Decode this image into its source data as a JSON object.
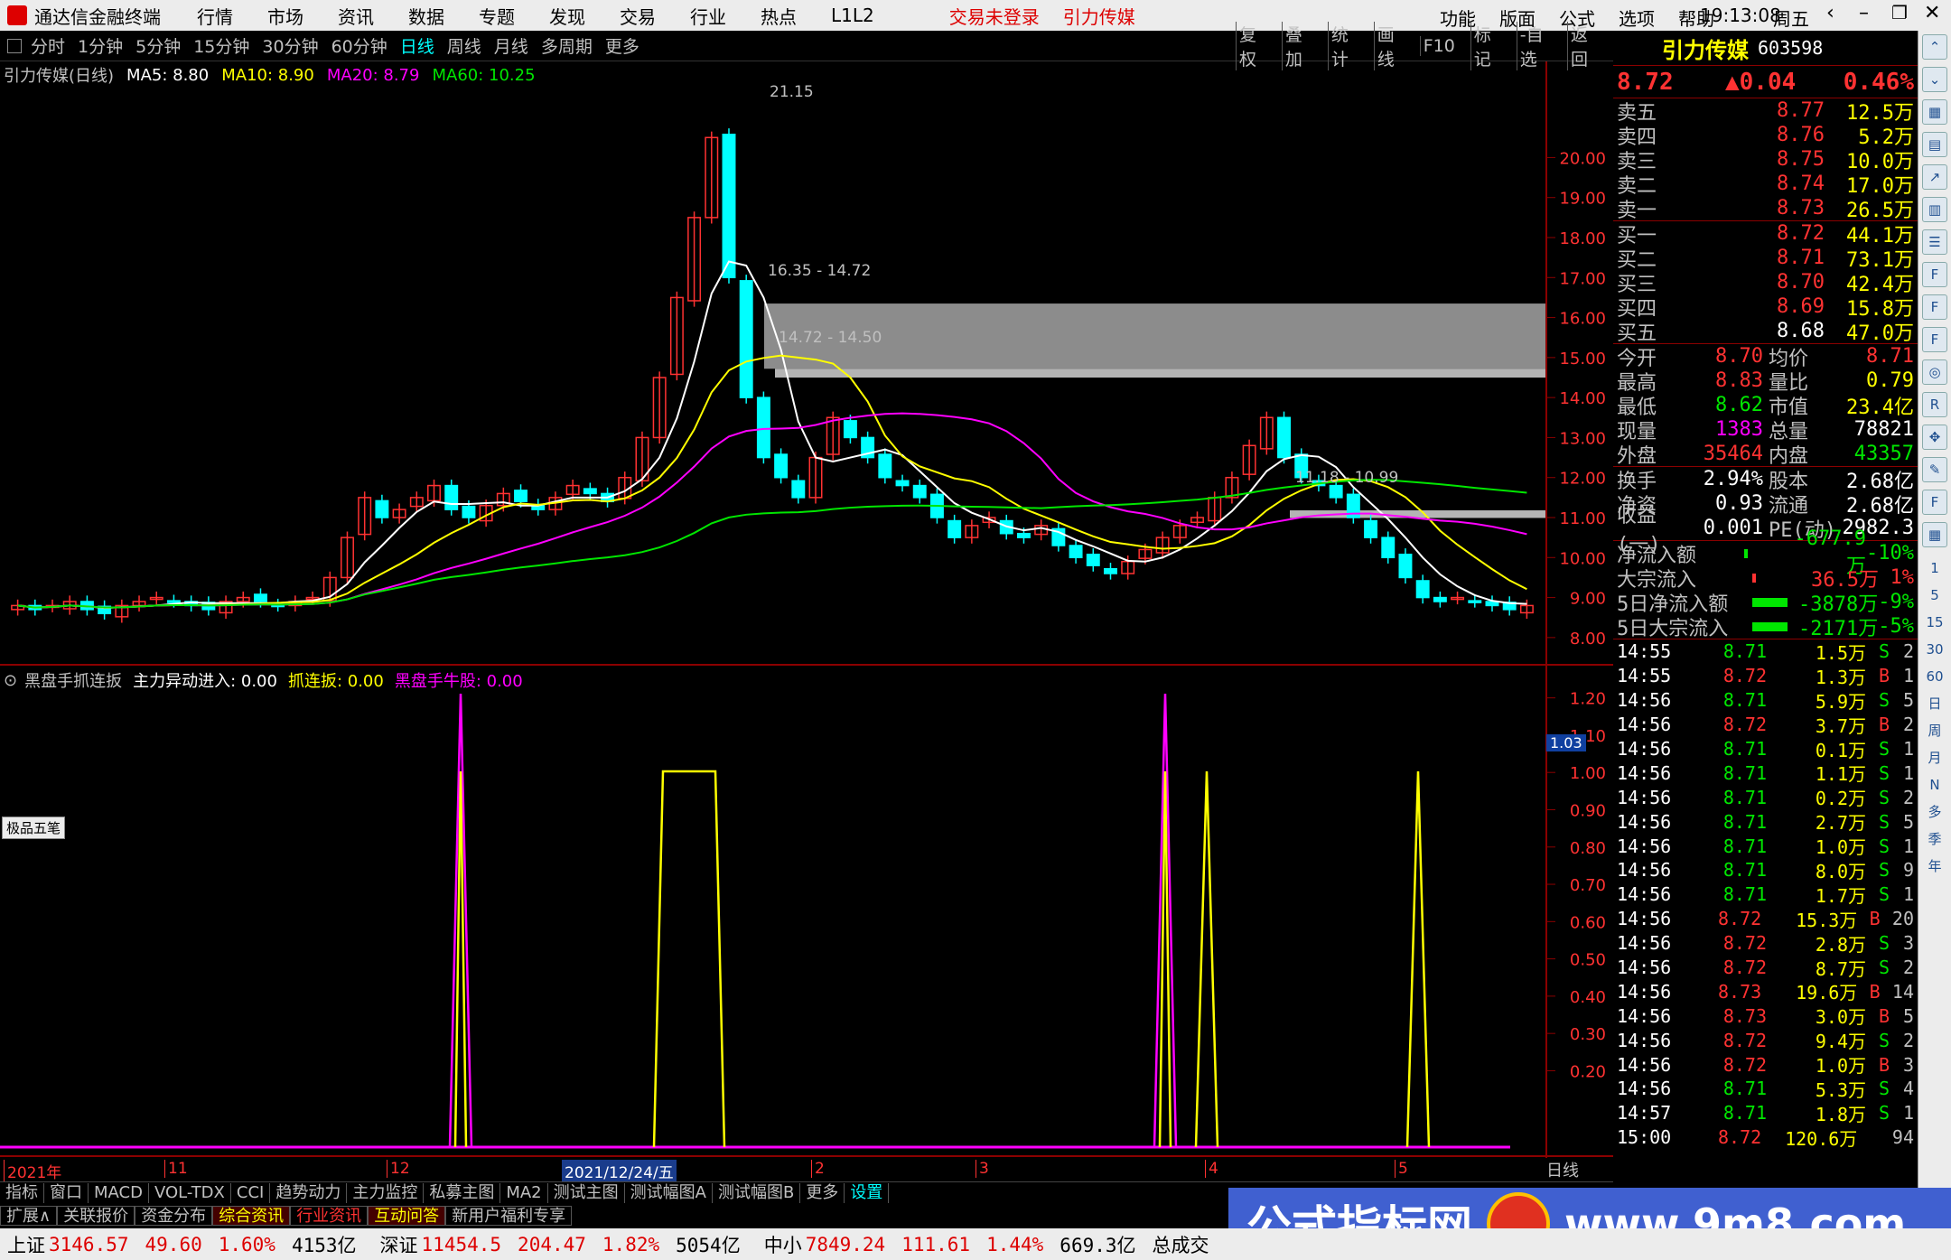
{
  "app": {
    "title": "通达信金融终端",
    "menu": [
      "行情",
      "市场",
      "资讯",
      "数据",
      "专题",
      "发现",
      "交易",
      "行业",
      "热点",
      "L1L2"
    ],
    "login_status": "交易未登录",
    "stock_name_top": "引力传媒",
    "right_menu": [
      "功能",
      "版面",
      "公式",
      "选项",
      "帮助"
    ],
    "time": "19:13:08",
    "weekday": "周五"
  },
  "periods": [
    "分时",
    "1分钟",
    "5分钟",
    "15分钟",
    "30分钟",
    "60分钟",
    "日线",
    "周线",
    "月线",
    "多周期",
    "更多"
  ],
  "active_period": "日线",
  "tools": [
    "复权",
    "叠加",
    "统计",
    "画线",
    "F10",
    "标记",
    "-自选",
    "返回"
  ],
  "chart_header": {
    "name": "引力传媒(日线)",
    "ma5": "MA5: 8.80",
    "ma10": "MA10: 8.90",
    "ma20": "MA20: 8.79",
    "ma60": "MA60: 10.25"
  },
  "indicator_header": {
    "name": "黑盘手抓连扳",
    "field1": "主力异动进入: 0.00",
    "field2": "抓连扳: 0.00",
    "field3": "黑盘手牛股: 0.00"
  },
  "drawing_toolbar": "极品五笔",
  "annotations": {
    "peak": "21.15",
    "zone1": "16.35 - 14.72",
    "zone2": "14.72 - 14.50",
    "zone3": "11.18 - 10.99",
    "cursor_value": "1.03"
  },
  "x_axis": {
    "labels": [
      "2021年",
      "11",
      "12",
      "2021/12/24/五",
      "2",
      "3",
      "4",
      "5"
    ],
    "mode": "日线"
  },
  "chart_data": [
    {
      "type": "line",
      "title": "引力传媒(日线)",
      "ylim": [
        7.5,
        21.5
      ],
      "y_ticks": [
        "8.00",
        "9.00",
        "10.00",
        "11.00",
        "12.00",
        "13.00",
        "14.00",
        "15.00",
        "16.00",
        "17.00",
        "18.00",
        "19.00",
        "20.00"
      ],
      "series": [
        {
          "name": "Close",
          "color": "#ff3232",
          "values": [
            8.8,
            8.7,
            8.8,
            8.9,
            8.7,
            8.6,
            8.8,
            8.9,
            9.0,
            8.9,
            8.8,
            8.7,
            8.9,
            9.0,
            8.9,
            8.8,
            8.9,
            9.0,
            9.5,
            10.5,
            11.5,
            11.0,
            11.2,
            11.5,
            11.8,
            11.2,
            11.0,
            11.3,
            11.6,
            11.4,
            11.2,
            11.5,
            11.8,
            11.6,
            11.4,
            12.0,
            13.0,
            14.5,
            16.5,
            18.5,
            20.5,
            17.0,
            14.0,
            12.5,
            12.0,
            11.5,
            12.5,
            13.5,
            13.0,
            12.5,
            12.0,
            11.8,
            11.5,
            11.0,
            10.5,
            10.8,
            11.0,
            10.6,
            10.5,
            10.8,
            10.3,
            10.0,
            9.8,
            9.6,
            9.9,
            10.2,
            10.5,
            10.8,
            11.0,
            11.5,
            12.0,
            12.8,
            13.5,
            12.5,
            12.0,
            11.8,
            11.5,
            11.0,
            10.5,
            10.0,
            9.5,
            9.0,
            8.9,
            9.0,
            8.9,
            8.8,
            8.7,
            8.8
          ]
        },
        {
          "name": "MA5",
          "color": "#ffffff",
          "values": []
        },
        {
          "name": "MA10",
          "color": "#ffff00",
          "values": []
        },
        {
          "name": "MA20",
          "color": "#ff00ff",
          "values": []
        },
        {
          "name": "MA60",
          "color": "#00e600",
          "values": []
        }
      ]
    },
    {
      "type": "line",
      "title": "黑盘手抓连扳",
      "ylim": [
        0,
        1.25
      ],
      "y_ticks": [
        "0.20",
        "0.30",
        "0.40",
        "0.50",
        "0.60",
        "0.70",
        "0.80",
        "0.90",
        "1.00",
        "1.10",
        "1.20"
      ],
      "series": [
        {
          "name": "主力异动进入",
          "color": "#ff00ff",
          "values": []
        },
        {
          "name": "抓连扳",
          "color": "#ffff00",
          "values": []
        }
      ]
    }
  ],
  "quote": {
    "name": "引力传媒",
    "code": "603598",
    "price": "8.72",
    "change": "▲0.04",
    "pct": "0.46%",
    "asks": [
      {
        "label": "卖五",
        "price": "8.77",
        "vol": "12.5万"
      },
      {
        "label": "卖四",
        "price": "8.76",
        "vol": "5.2万"
      },
      {
        "label": "卖三",
        "price": "8.75",
        "vol": "10.0万"
      },
      {
        "label": "卖二",
        "price": "8.74",
        "vol": "17.0万"
      },
      {
        "label": "卖一",
        "price": "8.73",
        "vol": "26.5万"
      }
    ],
    "bids": [
      {
        "label": "买一",
        "price": "8.72",
        "vol": "44.1万"
      },
      {
        "label": "买二",
        "price": "8.71",
        "vol": "73.1万"
      },
      {
        "label": "买三",
        "price": "8.70",
        "vol": "42.4万"
      },
      {
        "label": "买四",
        "price": "8.69",
        "vol": "15.8万"
      },
      {
        "label": "买五",
        "price": "8.68",
        "vol": "47.0万"
      }
    ],
    "stats": [
      {
        "l1": "今开",
        "v1": "8.70",
        "l2": "均价",
        "v2": "8.71"
      },
      {
        "l1": "最高",
        "v1": "8.83",
        "l2": "量比",
        "v2": "0.79"
      },
      {
        "l1": "最低",
        "v1": "8.62",
        "l2": "市值",
        "v2": "23.4亿"
      },
      {
        "l1": "现量",
        "v1": "1383",
        "l2": "总量",
        "v2": "78821"
      },
      {
        "l1": "外盘",
        "v1": "35464",
        "l2": "内盘",
        "v2": "43357"
      }
    ],
    "stats2": [
      {
        "l1": "换手",
        "v1": "2.94%",
        "l2": "股本",
        "v2": "2.68亿"
      },
      {
        "l1": "净资",
        "v1": "0.93",
        "l2": "流通",
        "v2": "2.68亿"
      },
      {
        "l1": "收益(一)",
        "v1": "0.001",
        "l2": "PE(动)",
        "v2": "2982.3"
      }
    ],
    "flows": [
      {
        "label": "净流入额",
        "val": "-677.9万",
        "pct": "-10%"
      },
      {
        "label": "大宗流入",
        "val": "36.5万",
        "pct": "1%"
      },
      {
        "label": "5日净流入额",
        "val": "-3878万",
        "pct": "-9%"
      },
      {
        "label": "5日大宗流入",
        "val": "-2171万",
        "pct": "-5%"
      }
    ],
    "ticks": [
      {
        "t": "14:55",
        "p": "8.71",
        "v": "1.5万",
        "s": "S",
        "n": "2"
      },
      {
        "t": "14:55",
        "p": "8.72",
        "v": "1.3万",
        "s": "B",
        "n": "1"
      },
      {
        "t": "14:56",
        "p": "8.71",
        "v": "5.9万",
        "s": "S",
        "n": "5"
      },
      {
        "t": "14:56",
        "p": "8.72",
        "v": "3.7万",
        "s": "B",
        "n": "2"
      },
      {
        "t": "14:56",
        "p": "8.71",
        "v": "0.1万",
        "s": "S",
        "n": "1"
      },
      {
        "t": "14:56",
        "p": "8.71",
        "v": "1.1万",
        "s": "S",
        "n": "1"
      },
      {
        "t": "14:56",
        "p": "8.71",
        "v": "0.2万",
        "s": "S",
        "n": "2"
      },
      {
        "t": "14:56",
        "p": "8.71",
        "v": "2.7万",
        "s": "S",
        "n": "5"
      },
      {
        "t": "14:56",
        "p": "8.71",
        "v": "1.0万",
        "s": "S",
        "n": "1"
      },
      {
        "t": "14:56",
        "p": "8.71",
        "v": "8.0万",
        "s": "S",
        "n": "9"
      },
      {
        "t": "14:56",
        "p": "8.71",
        "v": "1.7万",
        "s": "S",
        "n": "1"
      },
      {
        "t": "14:56",
        "p": "8.72",
        "v": "15.3万",
        "s": "B",
        "n": "20"
      },
      {
        "t": "14:56",
        "p": "8.72",
        "v": "2.8万",
        "s": "S",
        "n": "3"
      },
      {
        "t": "14:56",
        "p": "8.72",
        "v": "8.7万",
        "s": "S",
        "n": "2"
      },
      {
        "t": "14:56",
        "p": "8.73",
        "v": "19.6万",
        "s": "B",
        "n": "14"
      },
      {
        "t": "14:56",
        "p": "8.73",
        "v": "3.0万",
        "s": "B",
        "n": "5"
      },
      {
        "t": "14:56",
        "p": "8.72",
        "v": "9.4万",
        "s": "S",
        "n": "2"
      },
      {
        "t": "14:56",
        "p": "8.72",
        "v": "1.0万",
        "s": "B",
        "n": "3"
      },
      {
        "t": "14:56",
        "p": "8.71",
        "v": "5.3万",
        "s": "S",
        "n": "4"
      },
      {
        "t": "14:57",
        "p": "8.71",
        "v": "1.8万",
        "s": "S",
        "n": "1"
      },
      {
        "t": "15:00",
        "p": "8.72",
        "v": "120.6万",
        "s": "",
        "n": "94"
      }
    ]
  },
  "sidebar_icons": [
    "up-arrow-icon",
    "down-arrow-icon",
    "chart-icon",
    "grid-icon",
    "line-icon",
    "bar-icon",
    "list-icon",
    "f10-icon",
    "f2-icon",
    "f3-icon",
    "compass-icon",
    "rsi-icon",
    "move-icon",
    "pen-icon",
    "fs-icon",
    "grid2-icon"
  ],
  "sidebar_labels": [
    "1",
    "5",
    "15",
    "30",
    "60",
    "日",
    "周",
    "月",
    "N",
    "多",
    "季",
    "年"
  ],
  "bottom_tabs1": [
    "指标",
    "窗口",
    "MACD",
    "VOL-TDX",
    "CCI",
    "趋势动力",
    "主力监控",
    "私募主图",
    "MA2",
    "测试主图",
    "测试幅图A",
    "测试幅图B",
    "更多",
    "设置"
  ],
  "bottom_tabs2": [
    "扩展∧",
    "关联报价",
    "资金分布",
    "综合资讯",
    "行业资讯",
    "互动问答",
    "新用户福利专享"
  ],
  "status": [
    {
      "name": "上证",
      "val": "3146.57",
      "chg": "49.60",
      "pct": "1.60%",
      "amt": "4153亿"
    },
    {
      "name": "深证",
      "val": "11454.5",
      "chg": "204.47",
      "pct": "1.82%",
      "amt": "5054亿"
    },
    {
      "name": "中小",
      "val": "7849.24",
      "chg": "111.61",
      "pct": "1.44%",
      "amt": "669.3亿"
    }
  ],
  "status_tail": "总成交",
  "watermark": {
    "text": "公式指标网",
    "url": "www.9m8.com"
  }
}
